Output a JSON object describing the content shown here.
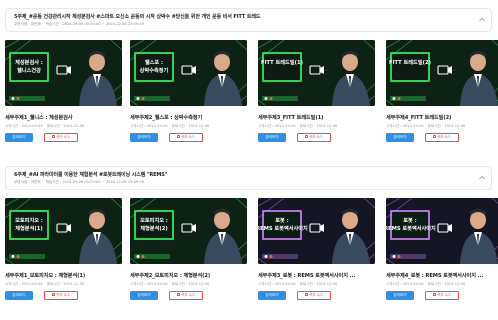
{
  "sections": [
    {
      "title": "5주제_#운동 건강관리시작 체성분검사 #스마트 오신소 운동의 시작 상박수 #당신을 위한 개인 운동 비서 FITT 트레드",
      "meta_label": "교안서명 : 이민희",
      "meta_period": "학습기간 : 2024-09-06 00:00:00 ~ 2024-12-06 23:59:59",
      "cards": [
        {
          "title": "세부주제1_웰니스 : 체성분검사",
          "thumb_text": "체성분검사 : 웰니스건강",
          "start": "시작시간 : 2024-09-06",
          "end": "종료시간 : 2024-12-06",
          "learn": "강의보기",
          "quiz": "퀴즈 0/1",
          "theme": "green"
        },
        {
          "title": "세부주제2_웰스포 : 상박수측정기",
          "thumb_text": "웰스포 : 상박수측정기",
          "start": "시작시간 : 2024-09-06",
          "end": "종료시간 : 2024-12-06",
          "learn": "강의보기",
          "quiz": "퀴즈 0/1",
          "theme": "green"
        },
        {
          "title": "세부주제3_FITT 트레드밀(1)",
          "thumb_text": "FITT 트레드밀(1)",
          "start": "시작시간 : 2024-09-06",
          "end": "종료시간 : 2024-12-06",
          "learn": "강의보기",
          "quiz": "퀴즈 0/1",
          "theme": "green"
        },
        {
          "title": "세부주제4_FITT 트레드밀(2)",
          "thumb_text": "FITT 트레드밀(2)",
          "start": "시작시간 : 2024-09-06",
          "end": "종료시간 : 2024-12-06",
          "learn": "강의보기",
          "quiz": "퀴즈 0/1",
          "theme": "green"
        }
      ]
    },
    {
      "title": "6주제_#AI 파라미터를 이용한 체험분석 #로봇트레이닝 시스템 \"REMS\"",
      "meta_label": "교안서명 : 이민희",
      "meta_period": "학습기간 : 2024-09-06 00:00:00 ~ 2024-12-06 23:59:59",
      "cards": [
        {
          "title": "세부주제1_모토피지오 : 체형분석(1)",
          "thumb_text": "모토피지오 : 체형분석(1)",
          "start": "시작시간 : 2024-09-06",
          "end": "종료시간 : 2024-12-06",
          "learn": "강의보기",
          "quiz": "퀴즈 0/1",
          "theme": "green"
        },
        {
          "title": "세부주제2_모토피지오 : 체형분석(2)",
          "thumb_text": "모토피지오 : 체형분석(2)",
          "start": "시작시간 : 2024-09-06",
          "end": "종료시간 : 2024-12-06",
          "learn": "강의보기",
          "quiz": "퀴즈 0/1",
          "theme": "green"
        },
        {
          "title": "세부주제3_로봇 : REMS 로봇엑서사이지 ...",
          "thumb_text": "로봇 : REMS 로봇엑서사이지",
          "start": "시작시간 : 2024-09-06",
          "end": "종료시간 : 2024-12-06",
          "learn": "강의보기",
          "quiz": "퀴즈 0/1",
          "theme": "purple"
        },
        {
          "title": "세부주제4_로봇 : REMS 로봇엑서사이지 ...",
          "thumb_text": "로봇 : REMS 로봇엑서사이지",
          "start": "시작시간 : 2024-09-06",
          "end": "종료시간 : 2024-12-06",
          "learn": "강의보기",
          "quiz": "퀴즈 0/1",
          "theme": "purple"
        }
      ]
    }
  ],
  "colors": {
    "learn_button": "#2f8fe0",
    "quiz_border": "#e24d4d",
    "thumb_green": "#39e25a",
    "thumb_purple": "#c07cf0"
  },
  "icons": {
    "section_toggle": "chevron-up-icon",
    "video": "video-camera-icon",
    "quiz": "quiz-icon"
  }
}
